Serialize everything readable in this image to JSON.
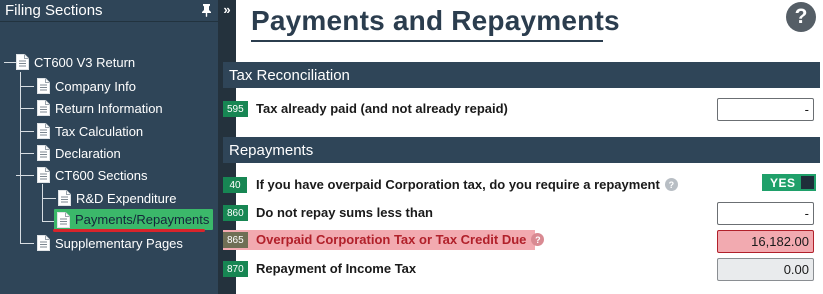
{
  "sidebar": {
    "title": "Filing Sections",
    "tree": {
      "root": "CT600 V3 Return",
      "items": [
        {
          "label": "Company Info"
        },
        {
          "label": "Return Information"
        },
        {
          "label": "Tax Calculation"
        },
        {
          "label": "Declaration"
        },
        {
          "label": "CT600 Sections"
        },
        {
          "label": "R&D Expenditure"
        },
        {
          "label": "Payments/Repayments"
        },
        {
          "label": "Supplementary Pages"
        }
      ],
      "active": "Payments/Repayments"
    }
  },
  "page": {
    "title": "Payments and Repayments",
    "help_symbol": "?"
  },
  "sections": {
    "tax_reconciliation": {
      "title": "Tax Reconciliation",
      "rows": [
        {
          "box": "595",
          "label": "Tax already paid (and not already repaid)",
          "value": "-"
        }
      ]
    },
    "repayments": {
      "title": "Repayments",
      "rows": [
        {
          "box": "40",
          "label": "If you have overpaid Corporation tax, do you require a repayment",
          "toggle": "YES"
        },
        {
          "box": "860",
          "label": "Do not repay sums less than",
          "value": "-"
        },
        {
          "box": "865",
          "label": "Overpaid Corporation Tax or Tax Credit Due",
          "value": "16,182.00"
        },
        {
          "box": "870",
          "label": "Repayment of Income Tax",
          "value": "0.00"
        }
      ]
    }
  },
  "colors": {
    "sidebar_bg": "#2f4558",
    "section_header_bg": "#2f4558",
    "box_number_bg": "#178653",
    "active_item_bg": "#3bb86a",
    "active_underline": "#d9242b",
    "highlight_bg": "#f2aab0",
    "highlight_text": "#b1202a",
    "toggle_bg": "#1fa06a"
  },
  "icons": {
    "pin": "pin-icon",
    "collapse": "double-chevron-right-icon",
    "document": "document-icon",
    "help": "help-circle-icon",
    "question": "question-icon"
  }
}
